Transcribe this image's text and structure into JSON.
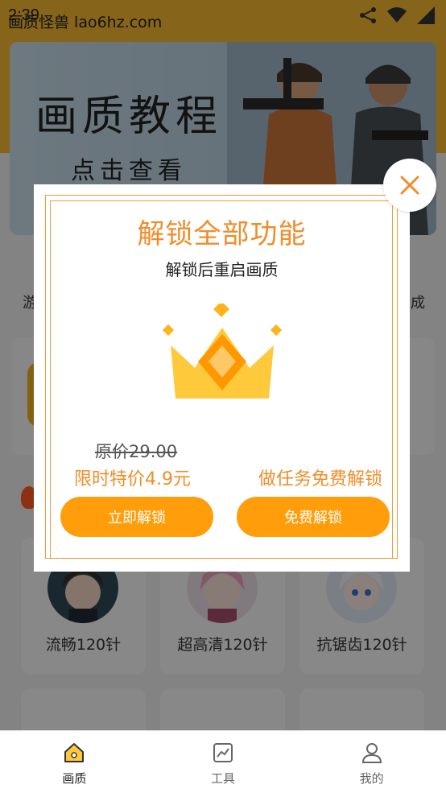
{
  "status_bar": {
    "time": "2:39",
    "app_title": "画质怪兽 lao6hz.com"
  },
  "banner": {
    "title": "画质教程",
    "subtitle": "点击查看"
  },
  "background": {
    "left_text": "游",
    "right_text": "成"
  },
  "grid": {
    "items": [
      {
        "label": "流畅120针"
      },
      {
        "label": "超高清120针"
      },
      {
        "label": "抗锯齿120针"
      }
    ]
  },
  "modal": {
    "title": "解锁全部功能",
    "subtitle": "解锁后重启画质",
    "original_price": "原价29.00",
    "promo_price": "限时特价4.9元",
    "promo_task": "做任务免费解锁",
    "buy_button": "立即解锁",
    "free_button": "免费解锁"
  },
  "bottom_nav": {
    "items": [
      {
        "label": "画质",
        "icon": "home-icon",
        "active": true
      },
      {
        "label": "工具",
        "icon": "chart-icon",
        "active": false
      },
      {
        "label": "我的",
        "icon": "user-icon",
        "active": false
      }
    ]
  },
  "colors": {
    "accent": "#f08d2a",
    "button": "#ff9e0a",
    "top_band": "#f4b731"
  }
}
